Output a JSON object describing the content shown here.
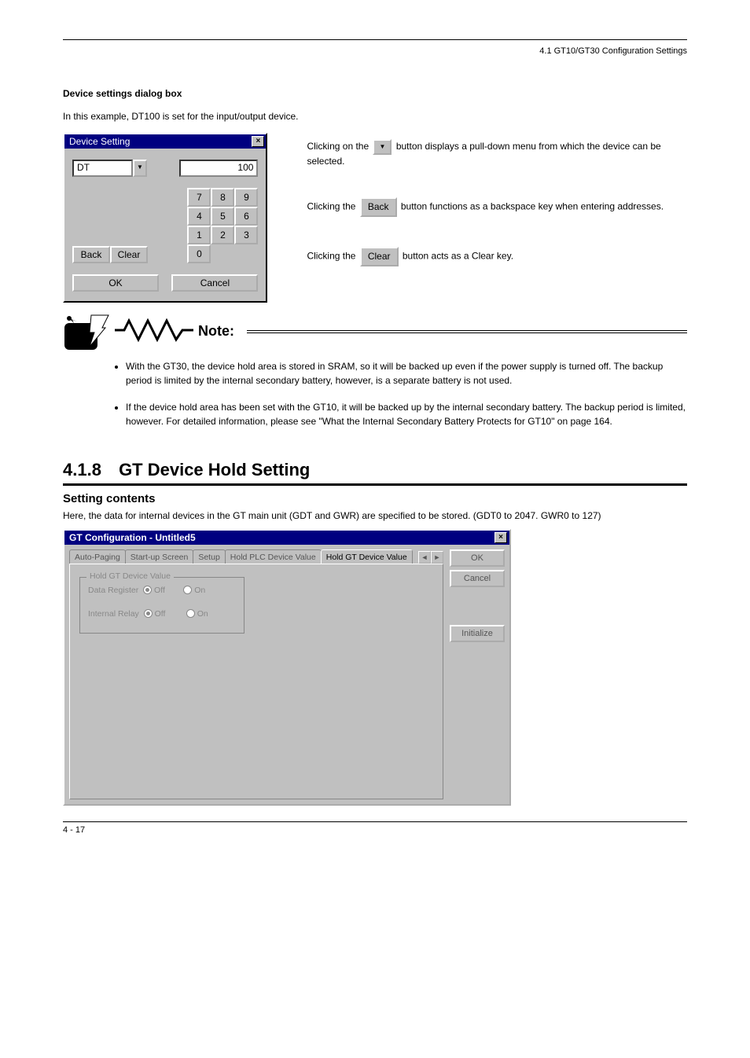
{
  "header": {
    "top_right": "4.1 GT10/GT30 Configuration Settings"
  },
  "intro": {
    "title": "Device settings dialog box",
    "text": "In this example, DT100 is set for the input/output device."
  },
  "deviceDialog": {
    "title": "Device Setting",
    "selectValue": "DT",
    "numValue": "100",
    "keys": [
      "7",
      "8",
      "9",
      "4",
      "5",
      "6",
      "1",
      "2",
      "3",
      "0"
    ],
    "back": "Back",
    "clear": "Clear",
    "ok": "OK",
    "cancel": "Cancel"
  },
  "rightCol": {
    "l1a": "Clicking on the ",
    "l1b": " button displays a pull-down menu from which the device can be selected.",
    "l2a": "Clicking the ",
    "l2b": " button functions as a backspace key when entering addresses.",
    "l3a": "Clicking the ",
    "l3b": " button acts as a Clear key."
  },
  "note": {
    "label": "Note:",
    "items": [
      "With the GT30, the device hold area is stored in SRAM, so it will be backed up even if the power supply is turned off. The backup period is limited by the internal secondary battery, however, is a separate battery is not used.",
      "If the device hold area has been set with the GT10, it will be backed up by the internal secondary battery. The backup period is limited, however. For detailed information, please see \"What the Internal Secondary Battery Protects for GT10\" on page 164."
    ]
  },
  "section": {
    "number": "4.1.8",
    "title": "GT Device Hold Setting",
    "subtitle": "Setting contents",
    "body": "Here, the data for internal devices in the GT main unit (GDT and GWR) are specified to be stored. (GDT0 to 2047. GWR0 to 127)"
  },
  "gtDialog": {
    "title": "GT Configuration - Untitled5",
    "tabs": [
      "Auto-Paging",
      "Start-up Screen",
      "Setup",
      "Hold PLC Device Value",
      "Hold GT Device Value"
    ],
    "activeTab": 4,
    "groupTitle": "Hold GT Device Value",
    "row1Label": "Data Register",
    "row2Label": "Internal Relay",
    "off": "Off",
    "on": "On",
    "ok": "OK",
    "cancel": "Cancel",
    "initialize": "Initialize"
  },
  "footer": {
    "page": "4 - 17"
  }
}
